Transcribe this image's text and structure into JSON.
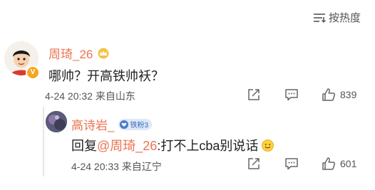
{
  "sort": {
    "label": "按热度",
    "icon": "sort-lines-icon"
  },
  "comment": {
    "author": "周琦_26",
    "author_avatar": "cartoon-avatar",
    "text": "哪帅？开高铁帅袄？",
    "date": "4-24 20:32",
    "location": "来自山东",
    "likes": "839",
    "name_color": "#eb7350"
  },
  "reply": {
    "author": "高诗岩_",
    "fan_badge": "铁粉3",
    "text_prefix": "回复",
    "mention": "@周琦_26",
    "text_body": ":打不上cba别说话",
    "emoji": "smile-emoji",
    "date": "4-24 20:33",
    "location": "来自辽宁",
    "likes": "601"
  },
  "icons": {
    "share": "share-icon",
    "comment": "comment-icon",
    "like": "thumbs-up-icon",
    "verified": "verified-v-icon",
    "crown": "crown-badge-icon"
  },
  "colors": {
    "accent": "#eb7350",
    "meta_text": "#555555",
    "badge_gold": "#f5a623"
  }
}
